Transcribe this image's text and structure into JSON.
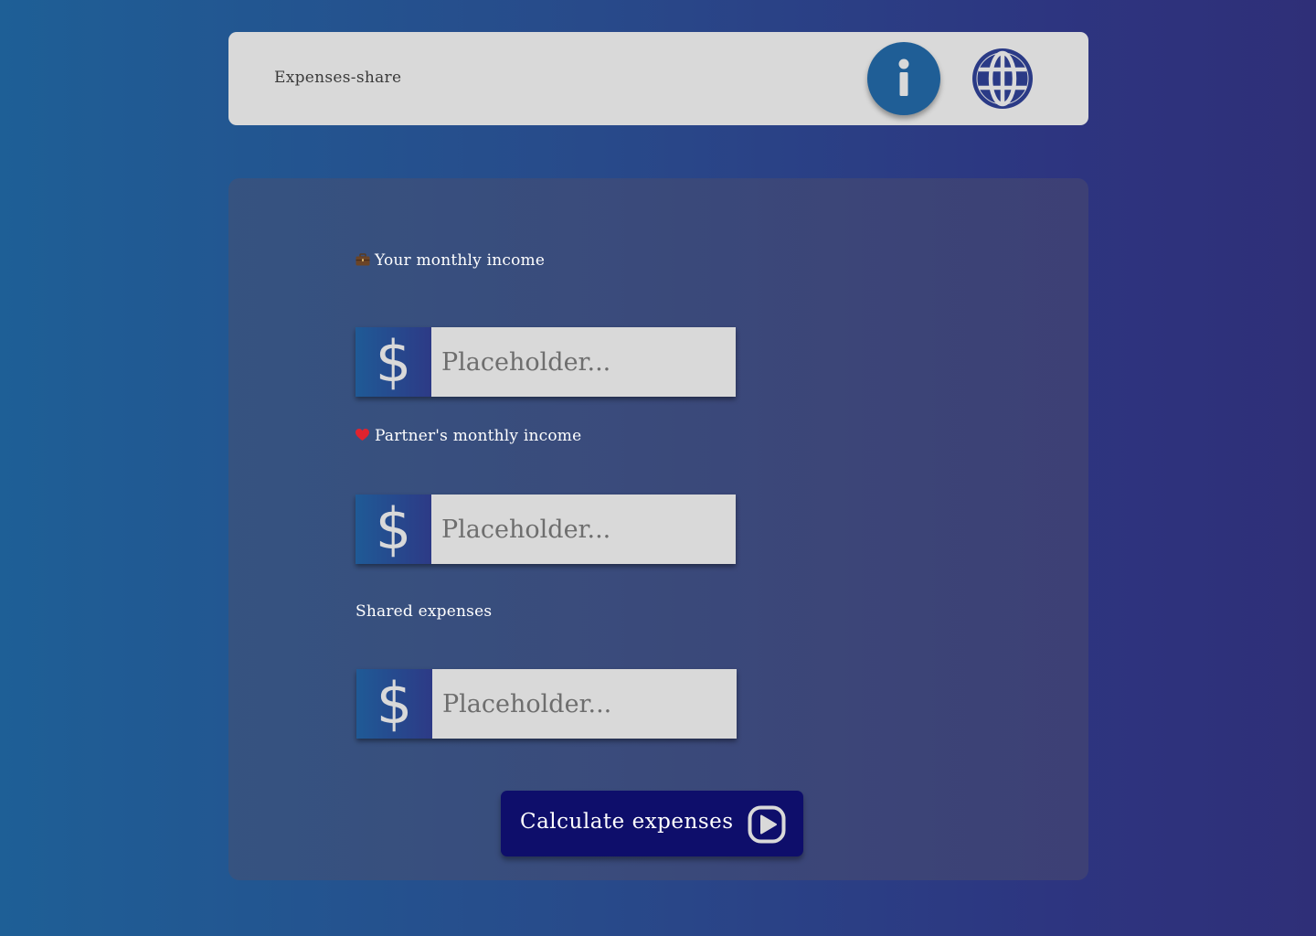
{
  "header": {
    "title": "Expenses-share",
    "info_icon": "info-icon",
    "language_icon": "globe-icon"
  },
  "form": {
    "fields": [
      {
        "label": "Your monthly income",
        "emoji": "💼",
        "prefix_icon": "dollar-icon",
        "placeholder": "Placeholder...",
        "value": ""
      },
      {
        "label": "Partner's monthly income",
        "emoji": "❤️",
        "prefix_icon": "dollar-icon",
        "placeholder": "Placeholder...",
        "value": ""
      },
      {
        "label": "Shared expenses",
        "emoji": "",
        "prefix_icon": "dollar-icon",
        "placeholder": "Placeholder...",
        "value": ""
      }
    ],
    "submit": {
      "label": "Calculate expenses",
      "icon": "play-circle-icon"
    }
  },
  "colors": {
    "header_bg": "#d9d9d9",
    "info_button": "#1f5e96",
    "globe": "#2a3a86",
    "submit_button": "#0e0e6b",
    "input_bg": "#d9d9d9"
  }
}
